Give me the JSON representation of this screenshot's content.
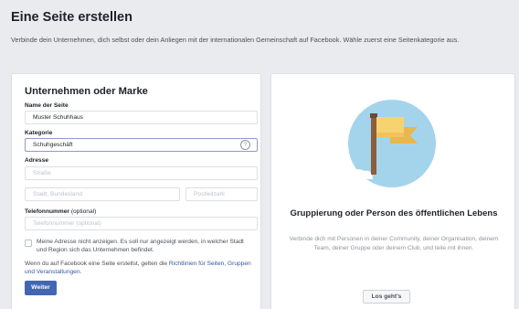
{
  "header": {
    "title": "Eine Seite erstellen",
    "subtitle": "Verbinde dein Unternehmen, dich selbst oder dein Anliegen mit der internationalen Gemeinschaft auf Facebook. Wähle zuerst eine Seitenkategorie aus."
  },
  "business_card": {
    "title": "Unternehmen oder Marke",
    "page_name": {
      "label": "Name der Seite",
      "value": "Muster Schuhhaus"
    },
    "category": {
      "label": "Kategorie",
      "value": "Schuhgeschäft",
      "help_icon": "question-circle-icon"
    },
    "address": {
      "label": "Adresse",
      "street_placeholder": "Straße",
      "city_placeholder": "Stadt, Bundesland",
      "zip_placeholder": "Postleitzahl"
    },
    "phone": {
      "label": "Telefonnummer",
      "label_suffix": " (optional)",
      "placeholder": "Telefonnummer (optional)"
    },
    "hide_address_checkbox": {
      "checked": false,
      "label": "Meine Adresse nicht anzeigen. Es soll nur angezeigt werden, in welcher Stadt und Region sich das Unternehmen befindet."
    },
    "policy": {
      "text": "Wenn du auf Facebook eine Seite erstellst, gelten die ",
      "link": "Richtlinien für Seiten, Gruppen und Veranstaltungen",
      "suffix": "."
    },
    "submit_label": "Weiter"
  },
  "community_card": {
    "illustration": "flag-illustration",
    "title": "Gruppierung oder Person des öffentlichen Lebens",
    "description": "Verbinde dich mit Personen in deiner Community, deiner Organisation, deinem Team, deiner Gruppe oder deinem Club, und teile mit ihnen.",
    "button_label": "Los geht's"
  },
  "colors": {
    "background": "#e9ebee",
    "primary_button": "#4267b2",
    "link": "#365899",
    "illustration_circle": "#a4d4ec",
    "flag": "#f7d270",
    "pole": "#8b5e3c"
  }
}
